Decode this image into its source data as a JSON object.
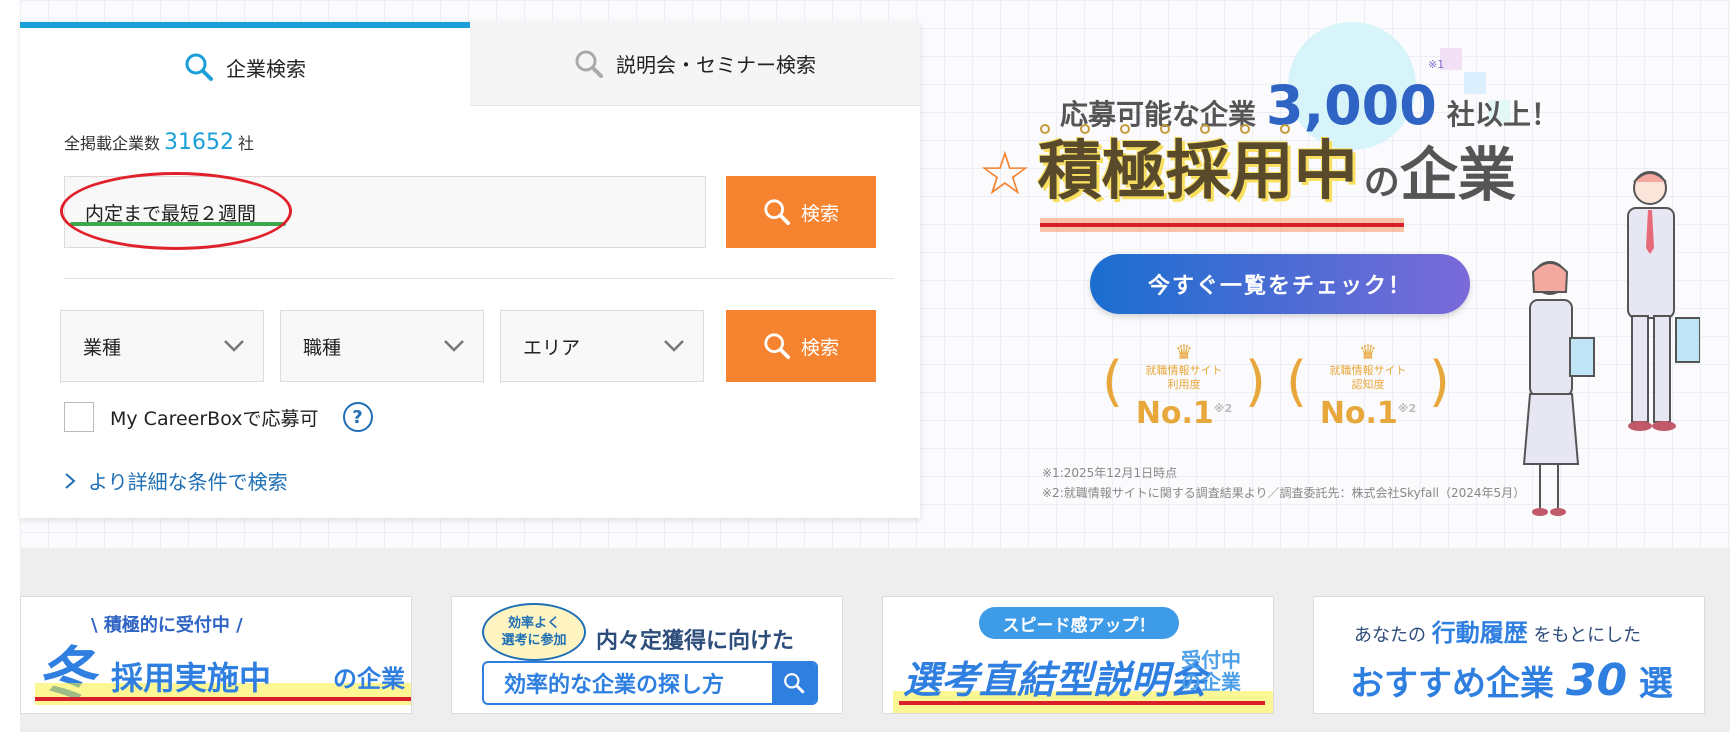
{
  "search": {
    "tabs": [
      {
        "label": "企業検索",
        "active": true
      },
      {
        "label": "説明会・セミナー検索",
        "active": false
      }
    ],
    "count_label": "全掲載企業数",
    "count_value": "31652",
    "count_unit": "社",
    "keyword_value": "内定まで最短２週間",
    "search_button_label": "検索",
    "selects": [
      {
        "label": "業種"
      },
      {
        "label": "職種"
      },
      {
        "label": "エリア"
      }
    ],
    "checkbox_label": "My CareerBoxで応募可",
    "help_label": "?",
    "detail_link": "より詳細な条件で検索"
  },
  "hero": {
    "sub_prefix": "応募可能な企業",
    "sub_number": "3,000",
    "sub_note": "※1",
    "sub_suffix": "社以上！",
    "star": "☆",
    "title_main": "積極採用中",
    "title_no": "の",
    "title_tail": "企業",
    "cta": "今すぐ一覧をチェック！",
    "awards": [
      {
        "label1": "就職情報サイト",
        "label2": "利用度",
        "rank": "No.1",
        "note": "※2"
      },
      {
        "label1": "就職情報サイト",
        "label2": "認知度",
        "rank": "No.1",
        "note": "※2"
      }
    ],
    "footnote1": "※1:2025年12月1日時点",
    "footnote2": "※2:就職情報サイトに関する調査結果より／調査委託先：株式会社Skyfall（2024年5月）"
  },
  "banners": {
    "b1": {
      "small": "\\ 積極的に受付中 /",
      "fuyu": "冬",
      "main": "採用実施中",
      "tail": "の企業"
    },
    "b2": {
      "bubble1": "効率よく",
      "bubble2": "選考に参加",
      "title": "内々定獲得に向けた",
      "box": "効率的な企業の探し方"
    },
    "b3": {
      "pill": "スピード感アップ！",
      "main": "選考直結型説明会",
      "tail1": "受付中",
      "tail2": "の企業"
    },
    "b4": {
      "top_a": "あなたの",
      "top_b": "行動履歴",
      "top_c": "をもとにした",
      "main": "おすすめ企業",
      "num": "30",
      "suffix": "選"
    }
  },
  "colors": {
    "accent_blue": "#1b9fd8",
    "orange": "#f5832f",
    "link": "#1f6fb5"
  },
  "icons": {
    "search": "search-icon",
    "chevron": "chevron-down-icon",
    "arrow": "chevron-right-icon"
  }
}
